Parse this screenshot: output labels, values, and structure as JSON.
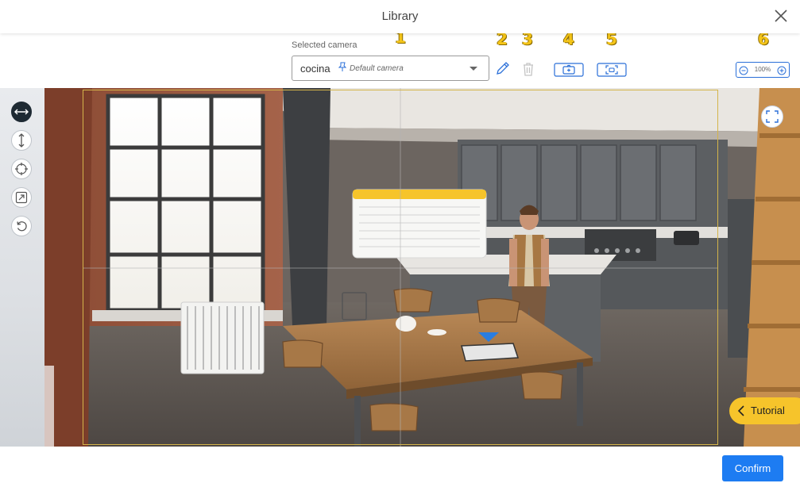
{
  "header": {
    "title": "Library",
    "close_icon": "close-icon"
  },
  "camera": {
    "label": "Selected camera",
    "selected_name": "cocina",
    "default_text": "Default camera",
    "pin_icon": "pin-icon",
    "dropdown_icon": "caret-down-icon"
  },
  "toolbar": {
    "markers": [
      "1",
      "2",
      "3",
      "4",
      "5",
      "6"
    ],
    "edit_icon": "pencil-icon",
    "delete_icon": "trash-icon",
    "add_camera_icon": "camera-add-icon",
    "capture_icon": "screen-capture-icon",
    "zoom": {
      "value": "100%",
      "minus_icon": "zoom-out-icon",
      "plus_icon": "zoom-in-icon"
    }
  },
  "side_tools": [
    {
      "name": "pan-horizontal",
      "icon": "arrow-left-right-icon",
      "active": true
    },
    {
      "name": "pan-vertical",
      "icon": "arrow-up-down-icon",
      "active": false
    },
    {
      "name": "orbit",
      "icon": "orbit-icon",
      "active": false
    },
    {
      "name": "scale",
      "icon": "resize-icon",
      "active": false
    },
    {
      "name": "reset",
      "icon": "reset-icon",
      "active": false
    }
  ],
  "viewport": {
    "fullscreen_icon": "fullscreen-icon",
    "frame_color": "#d4b44a"
  },
  "tutorial": {
    "label": "Tutorial",
    "icon": "chevron-left-icon"
  },
  "footer": {
    "confirm_label": "Confirm"
  },
  "colors": {
    "accent": "#1d7cf2",
    "tutorial_bg": "#f6c42b",
    "marker": "#f5c518"
  }
}
